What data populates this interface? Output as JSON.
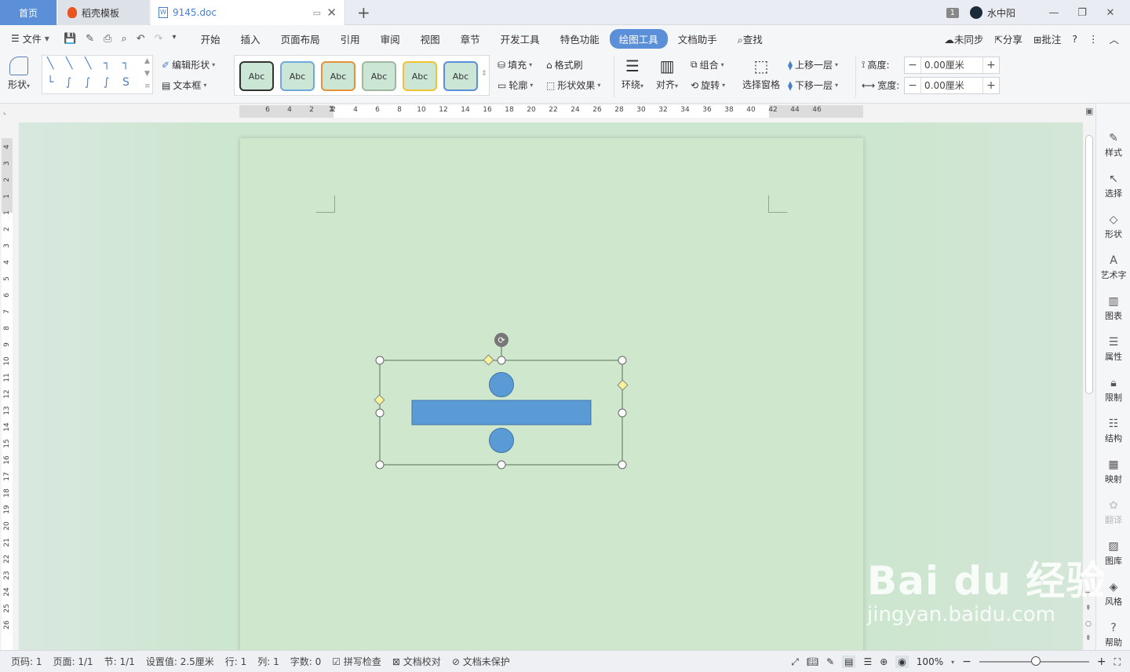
{
  "titlebar": {
    "tabs": [
      "首页",
      "稻壳模板",
      "9145.doc"
    ],
    "badge": "1",
    "user": "水中阳"
  },
  "menubar": {
    "file": "文件",
    "items": [
      "开始",
      "插入",
      "页面布局",
      "引用",
      "审阅",
      "视图",
      "章节",
      "开发工具",
      "特色功能",
      "绘图工具",
      "文档助手"
    ],
    "search": "查找",
    "sync": "未同步",
    "share": "分享",
    "comment": "批注"
  },
  "ribbon": {
    "shape": "形状",
    "edit_shape": "编辑形状",
    "textbox": "文本框",
    "style_label": "Abc",
    "fill": "填充",
    "format_painter": "格式刷",
    "outline": "轮廓",
    "shape_effect": "形状效果",
    "wrap": "环绕",
    "align": "对齐",
    "group": "组合",
    "rotate": "旋转",
    "select_pane": "选择窗格",
    "bring_forward": "上移一层",
    "send_backward": "下移一层",
    "height_label": "高度:",
    "width_label": "宽度:",
    "height_value": "0.00厘米",
    "width_value": "0.00厘米"
  },
  "ruler": {
    "h_ticks": [
      "6",
      "4",
      "2",
      "2",
      "4",
      "6",
      "8",
      "10",
      "12",
      "14",
      "16",
      "18",
      "20",
      "22",
      "24",
      "26",
      "28",
      "30",
      "32",
      "34",
      "36",
      "38",
      "40",
      "42",
      "44",
      "46"
    ],
    "v_ticks": [
      "4",
      "3",
      "2",
      "1",
      "1",
      "2",
      "3",
      "4",
      "5",
      "6",
      "7",
      "8",
      "9",
      "10",
      "11",
      "12",
      "13",
      "14",
      "15",
      "16",
      "17",
      "18",
      "19",
      "20",
      "21",
      "22",
      "23",
      "24",
      "25",
      "26"
    ]
  },
  "right_panel": [
    "样式",
    "选择",
    "形状",
    "艺术字",
    "图表",
    "属性",
    "限制",
    "结构",
    "映射",
    "翻译",
    "图库",
    "风格",
    "帮助"
  ],
  "statusbar": {
    "page_num": "页码: 1",
    "pages": "页面: 1/1",
    "section": "节: 1/1",
    "setting": "设置值: 2.5厘米",
    "row": "行: 1",
    "col": "列: 1",
    "words": "字数: 0",
    "spell": "拼写检查",
    "proof": "文档校对",
    "protect": "文档未保护",
    "zoom": "100%"
  },
  "watermark": {
    "main": "Bai du 经验",
    "sub": "jingyan.baidu.com"
  },
  "colors": {
    "accent": "#5b8fd8",
    "page_bg": "#cfe8cd",
    "shape_fill": "#5b9bd5"
  }
}
